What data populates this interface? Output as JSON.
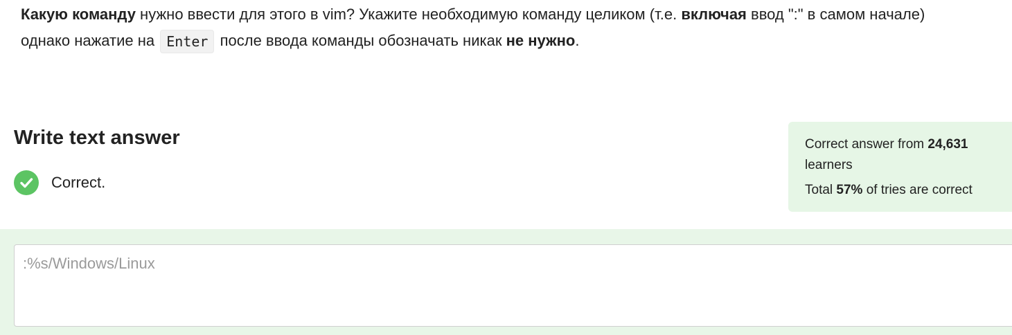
{
  "question": {
    "line1_bold1": "Какую команду",
    "line1_text1": " нужно ввести для этого в vim? Укажите необходимую команду целиком (т.е. ",
    "line1_bold2": "включая",
    "line1_text2": " ввод \":\" в самом начале)",
    "line2_text1": "однако нажатие на ",
    "line2_code": "Enter",
    "line2_text2": " после ввода команды обозначать никак ",
    "line2_bold": "не нужно",
    "line2_text3": "."
  },
  "answer_section": {
    "title": "Write text answer",
    "status_icon": "check-circle-icon",
    "status_text": "Correct.",
    "status_color": "#5cc463"
  },
  "stats": {
    "text1": "Correct answer from ",
    "learners_count": "24,631",
    "text2": "learners",
    "text3": "Total ",
    "percent": "57%",
    "text4": " of tries are correct",
    "background": "#e6f6e6"
  },
  "answer_input": {
    "value": ":%s/Windows/Linux"
  }
}
